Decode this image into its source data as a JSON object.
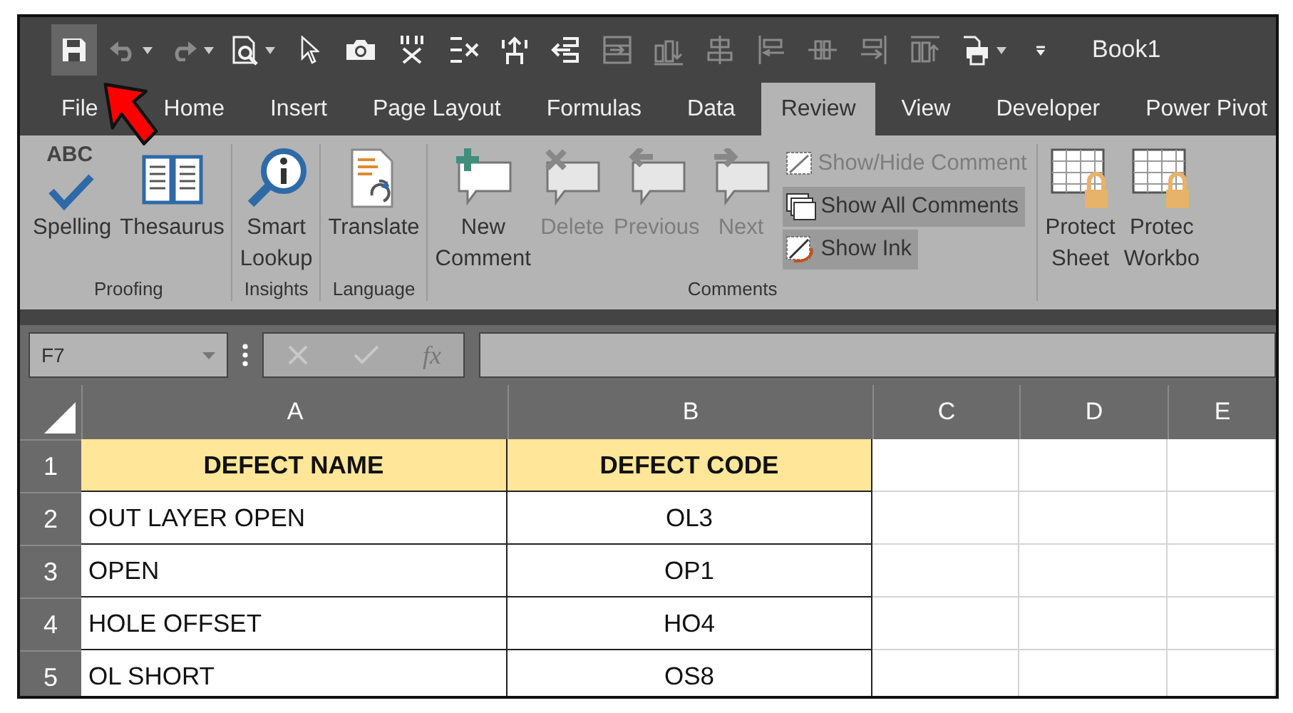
{
  "quick_access": [
    {
      "kind": "save",
      "highlighted": true,
      "dropdown": false,
      "disabled": false
    },
    {
      "kind": "undo",
      "highlighted": false,
      "dropdown": true,
      "disabled": true
    },
    {
      "kind": "redo",
      "highlighted": false,
      "dropdown": true,
      "disabled": true
    },
    {
      "kind": "preview",
      "highlighted": false,
      "dropdown": true,
      "disabled": false
    },
    {
      "kind": "pointer",
      "highlighted": false,
      "dropdown": false,
      "disabled": false
    },
    {
      "kind": "camera",
      "highlighted": false,
      "dropdown": false,
      "disabled": false
    },
    {
      "kind": "split",
      "highlighted": false,
      "dropdown": false,
      "disabled": false
    },
    {
      "kind": "lines-x",
      "highlighted": false,
      "dropdown": false,
      "disabled": false
    },
    {
      "kind": "up-arrow",
      "highlighted": false,
      "dropdown": false,
      "disabled": false
    },
    {
      "kind": "left-arrow",
      "highlighted": false,
      "dropdown": false,
      "disabled": false
    },
    {
      "kind": "table-arrow",
      "highlighted": false,
      "dropdown": false,
      "disabled": true
    },
    {
      "kind": "bars-down",
      "highlighted": false,
      "dropdown": false,
      "disabled": true
    },
    {
      "kind": "align-center",
      "highlighted": false,
      "dropdown": false,
      "disabled": true
    },
    {
      "kind": "align-left",
      "highlighted": false,
      "dropdown": false,
      "disabled": true
    },
    {
      "kind": "middle",
      "highlighted": false,
      "dropdown": false,
      "disabled": true
    },
    {
      "kind": "align-right",
      "highlighted": false,
      "dropdown": false,
      "disabled": true
    },
    {
      "kind": "bars-up",
      "highlighted": false,
      "dropdown": false,
      "disabled": true
    },
    {
      "kind": "print",
      "highlighted": false,
      "dropdown": true,
      "disabled": false
    },
    {
      "kind": "customize",
      "highlighted": false,
      "dropdown": false,
      "disabled": false
    }
  ],
  "title": "Book1",
  "tabs": [
    {
      "label": "File",
      "selected": false
    },
    {
      "label": "Home",
      "selected": false
    },
    {
      "label": "Insert",
      "selected": false
    },
    {
      "label": "Page Layout",
      "selected": false
    },
    {
      "label": "Formulas",
      "selected": false
    },
    {
      "label": "Data",
      "selected": false
    },
    {
      "label": "Review",
      "selected": true
    },
    {
      "label": "View",
      "selected": false
    },
    {
      "label": "Developer",
      "selected": false
    },
    {
      "label": "Power Pivot",
      "selected": false
    }
  ],
  "ribbon_groups": [
    {
      "label": "Proofing",
      "buttons": [
        {
          "kind": "spelling",
          "icon_text": "ABC",
          "lines": [
            "Spelling"
          ],
          "disabled": false
        },
        {
          "kind": "thesaurus",
          "lines": [
            "Thesaurus"
          ],
          "disabled": false
        }
      ]
    },
    {
      "label": "Insights",
      "buttons": [
        {
          "kind": "lookup",
          "lines": [
            "Smart",
            "Lookup"
          ],
          "disabled": false
        }
      ]
    },
    {
      "label": "Language",
      "buttons": [
        {
          "kind": "translate",
          "lines": [
            "Translate"
          ],
          "disabled": false
        }
      ]
    },
    {
      "label": "Comments",
      "buttons": [
        {
          "kind": "new-comment",
          "lines": [
            "New",
            "Comment"
          ],
          "disabled": false
        },
        {
          "kind": "delete-comment",
          "lines": [
            "Delete"
          ],
          "disabled": true
        },
        {
          "kind": "previous-comment",
          "lines": [
            "Previous"
          ],
          "disabled": true
        },
        {
          "kind": "next-comment",
          "lines": [
            "Next"
          ],
          "disabled": true
        }
      ],
      "small_buttons": [
        {
          "kind": "show-hide",
          "label": "Show/Hide Comment",
          "disabled": true,
          "highlighted": false
        },
        {
          "kind": "show-all",
          "label": "Show All Comments",
          "disabled": false,
          "highlighted": true
        },
        {
          "kind": "ink",
          "label": "Show Ink",
          "disabled": false,
          "highlighted": true
        }
      ]
    },
    {
      "buttons": [
        {
          "kind": "protect",
          "lines": [
            "Protect",
            "Sheet"
          ],
          "disabled": false
        },
        {
          "kind": "protect-book",
          "lines": [
            "Protec",
            "Workbo"
          ],
          "disabled": false
        }
      ]
    }
  ],
  "formula_bar": {
    "name_box": "F7",
    "fx_label": "fx"
  },
  "columns": [
    {
      "label": "A"
    },
    {
      "label": "B"
    },
    {
      "label": "C"
    },
    {
      "label": "D"
    },
    {
      "label": "E"
    }
  ],
  "rows": [
    {
      "number": "1",
      "kind": "header",
      "cells": [
        "DEFECT NAME",
        "DEFECT CODE",
        "",
        "",
        ""
      ]
    },
    {
      "number": "2",
      "kind": "data",
      "cells": [
        "OUT LAYER OPEN",
        "OL3",
        "",
        "",
        ""
      ]
    },
    {
      "number": "3",
      "kind": "data",
      "cells": [
        "OPEN",
        "OP1",
        "",
        "",
        ""
      ]
    },
    {
      "number": "4",
      "kind": "data",
      "cells": [
        "HOLE OFFSET",
        "HO4",
        "",
        "",
        ""
      ]
    },
    {
      "number": "5",
      "kind": "data",
      "cells": [
        "OL SHORT",
        "OS8",
        "",
        "",
        ""
      ]
    }
  ]
}
